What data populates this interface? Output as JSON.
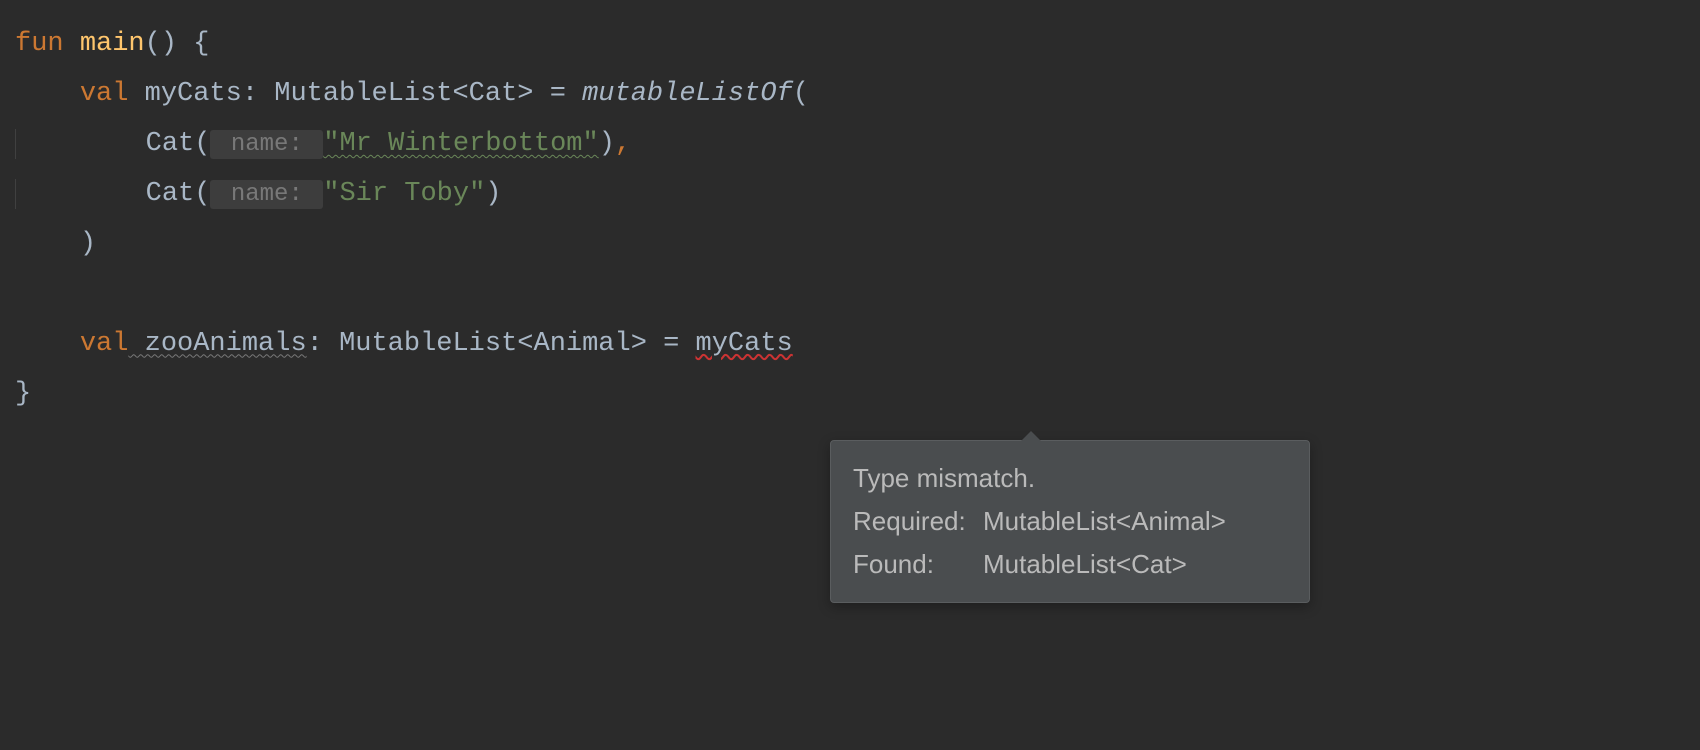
{
  "code": {
    "line1": {
      "fun": "fun",
      "main": "main",
      "parens": "()",
      "brace": " {"
    },
    "line2": {
      "indent": "    ",
      "val": "val",
      "myCats": " myCats",
      "colon": ": ",
      "type": "MutableList<Cat>",
      "equals": " = ",
      "mutableListOf": "mutableListOf",
      "openParen": "("
    },
    "line3": {
      "indent": "        ",
      "Cat": "Cat(",
      "hint": " name: ",
      "string": "\"Mr Winterbottom\"",
      "close": ")",
      "comma": ","
    },
    "line4": {
      "indent": "        ",
      "Cat": "Cat(",
      "hint": " name: ",
      "string": "\"Sir Toby\"",
      "close": ")"
    },
    "line5": {
      "indent": "    ",
      "close": ")"
    },
    "line6": {
      "blank": ""
    },
    "line7": {
      "indent": "    ",
      "val": "val",
      "zooAnimals": " zooAnimals",
      "colon": ": ",
      "type": "MutableList<Animal>",
      "equals": " = ",
      "myCats": "myCats"
    },
    "line8": {
      "brace": "}"
    }
  },
  "tooltip": {
    "title": "Type mismatch.",
    "requiredLabel": "Required:",
    "requiredValue": "MutableList<Animal>",
    "foundLabel": "Found:",
    "foundValue": "MutableList<Cat>"
  }
}
